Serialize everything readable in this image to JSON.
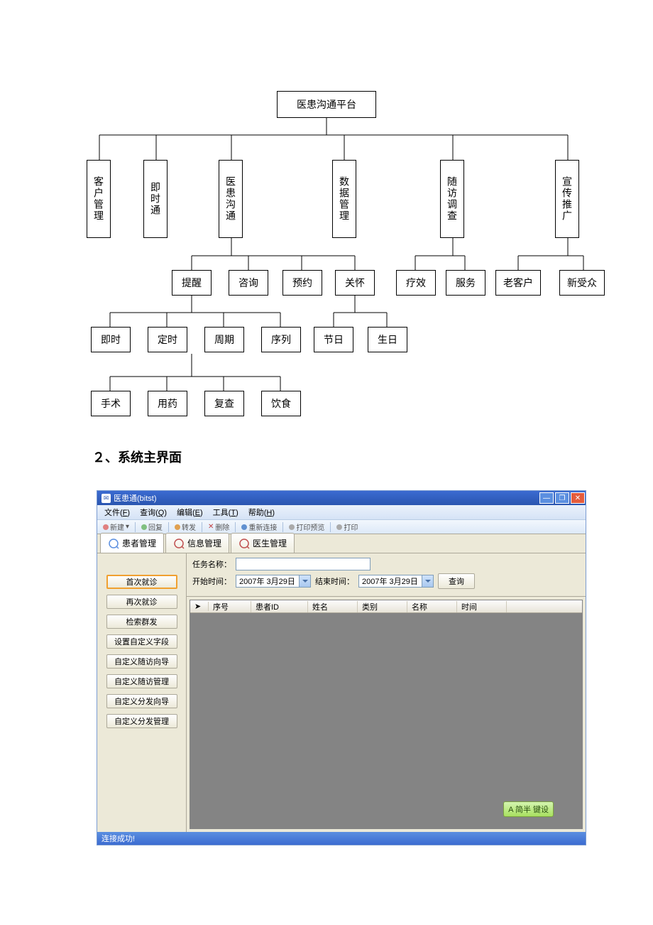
{
  "heading": "２、系统主界面",
  "diagram": {
    "root": "医患沟通平台",
    "level2": [
      "客户管理",
      "即时通",
      "医患沟通",
      "数据管理",
      "随访调查",
      "宣传推广"
    ],
    "level3": {
      "yhgt": [
        "提醒",
        "咨询",
        "预约",
        "关怀"
      ],
      "sfdc": [
        "疗效",
        "服务"
      ],
      "xctg": [
        "老客户",
        "新受众"
      ]
    },
    "level4": {
      "tixing": [
        "即时",
        "定时",
        "周期",
        "序列"
      ],
      "guanhuai": [
        "节日",
        "生日"
      ]
    },
    "level5": {
      "shouji": [
        "手术",
        "用药",
        "复查",
        "饮食"
      ]
    }
  },
  "app": {
    "title": "医患通(bitst)",
    "menu": [
      {
        "label": "文件",
        "key": "F"
      },
      {
        "label": "查询",
        "key": "Q"
      },
      {
        "label": "编辑",
        "key": "E"
      },
      {
        "label": "工具",
        "key": "T"
      },
      {
        "label": "帮助",
        "key": "H"
      }
    ],
    "toolbar1": [
      "新建",
      "回复",
      "转发",
      "删除",
      "重新连接",
      "打印预览",
      "打印"
    ],
    "tabs": [
      "患者管理",
      "信息管理",
      "医生管理"
    ],
    "sidebar": [
      "首次就诊",
      "再次就诊",
      "检索群发",
      "设置自定义字段",
      "自定义随访向导",
      "自定义随访管理",
      "自定义分发向导",
      "自定义分发管理"
    ],
    "filter": {
      "task_label": "任务名称：",
      "start_label": "开始时间：",
      "end_label": "结束时间：",
      "date": "2007年 3月29日",
      "query": "查询"
    },
    "columns": [
      "序号",
      "患者ID",
      "姓名",
      "类别",
      "名称",
      "时间"
    ],
    "ime": "A 简半 键设",
    "status": "连接成功!"
  }
}
